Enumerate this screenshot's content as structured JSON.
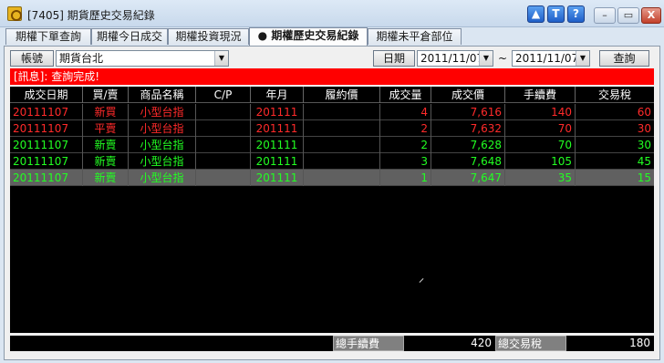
{
  "window": {
    "title": "[7405] 期貨歷史交易紀錄",
    "help_buttons": [
      "▲",
      "T",
      "?"
    ],
    "controls": [
      "–",
      "▭",
      "X"
    ]
  },
  "tabs": [
    {
      "label": "期權下單查詢",
      "active": false
    },
    {
      "label": "期權今日成交",
      "active": false
    },
    {
      "label": "期權投資現況",
      "active": false
    },
    {
      "label": "● 期權歷史交易紀錄",
      "active": true
    },
    {
      "label": "期權未平倉部位",
      "active": false
    }
  ],
  "toolbar": {
    "account_label": "帳號",
    "account_value": "期貨台北",
    "date_label": "日期",
    "date_from": "2011/11/07",
    "date_sep": "~",
    "date_to": "2011/11/07",
    "query_button": "查詢"
  },
  "message": "[訊息]: 查詢完成!",
  "table": {
    "columns": [
      "成交日期",
      "買/賣",
      "商品名稱",
      "C/P",
      "年月",
      "履約價",
      "成交量",
      "成交價",
      "手續費",
      "交易稅"
    ],
    "rows": [
      {
        "date": "20111107",
        "side": "新買",
        "product": "小型台指",
        "cp": "",
        "ym": "201111",
        "strike": "",
        "qty": "4",
        "price": "7,616",
        "fee": "140",
        "tax": "60",
        "color": "red",
        "selected": false
      },
      {
        "date": "20111107",
        "side": "平賣",
        "product": "小型台指",
        "cp": "",
        "ym": "201111",
        "strike": "",
        "qty": "2",
        "price": "7,632",
        "fee": "70",
        "tax": "30",
        "color": "red",
        "selected": false
      },
      {
        "date": "20111107",
        "side": "新賣",
        "product": "小型台指",
        "cp": "",
        "ym": "201111",
        "strike": "",
        "qty": "2",
        "price": "7,628",
        "fee": "70",
        "tax": "30",
        "color": "green",
        "selected": false
      },
      {
        "date": "20111107",
        "side": "新賣",
        "product": "小型台指",
        "cp": "",
        "ym": "201111",
        "strike": "",
        "qty": "3",
        "price": "7,648",
        "fee": "105",
        "tax": "45",
        "color": "green",
        "selected": false
      },
      {
        "date": "20111107",
        "side": "新賣",
        "product": "小型台指",
        "cp": "",
        "ym": "201111",
        "strike": "",
        "qty": "1",
        "price": "7,647",
        "fee": "35",
        "tax": "15",
        "color": "green",
        "selected": true
      }
    ]
  },
  "footer": {
    "total_fee_label": "總手續費",
    "total_fee_value": "420",
    "total_tax_label": "總交易稅",
    "total_tax_value": "180"
  },
  "colors": {
    "buy": "#ff2a2a",
    "sell": "#22ff22",
    "message_bg": "#ff0000",
    "grid_bg": "#000000"
  }
}
